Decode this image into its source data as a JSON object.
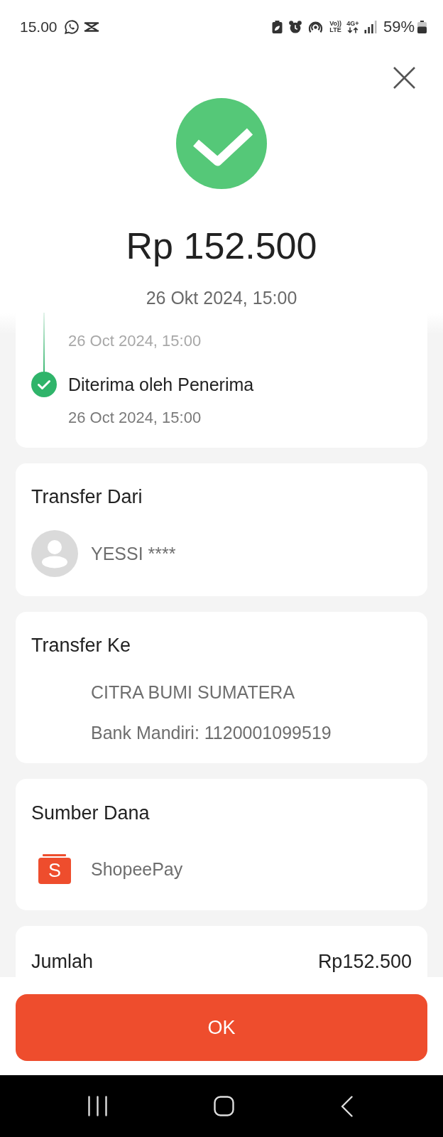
{
  "status_bar": {
    "time": "15.00",
    "volte_top": "Vo))",
    "volte_bottom": "LTE",
    "network": "4G+",
    "battery": "59%"
  },
  "header": {
    "amount": "Rp 152.500",
    "date": "26 Okt 2024, 15:00"
  },
  "timeline": [
    {
      "time": "26 Oct 2024, 15:00"
    },
    {
      "title": "Diterima oleh Penerima",
      "time": "26 Oct 2024, 15:00",
      "done": true
    }
  ],
  "sections": [
    {
      "kind": "avatar",
      "title": "Transfer Dari",
      "lines": [
        "YESSI ****"
      ]
    },
    {
      "kind": "plain",
      "title": "Transfer Ke",
      "lines": [
        "CITRA BUMI SUMATERA",
        "Bank Mandiri: 1120001099519"
      ]
    },
    {
      "kind": "wallet",
      "title": "Sumber Dana",
      "lines": [
        "ShopeePay"
      ],
      "logo_letter": "S"
    }
  ],
  "summary": [
    {
      "label": "Jumlah",
      "value": "Rp152.500"
    }
  ],
  "button": {
    "label": "OK"
  }
}
